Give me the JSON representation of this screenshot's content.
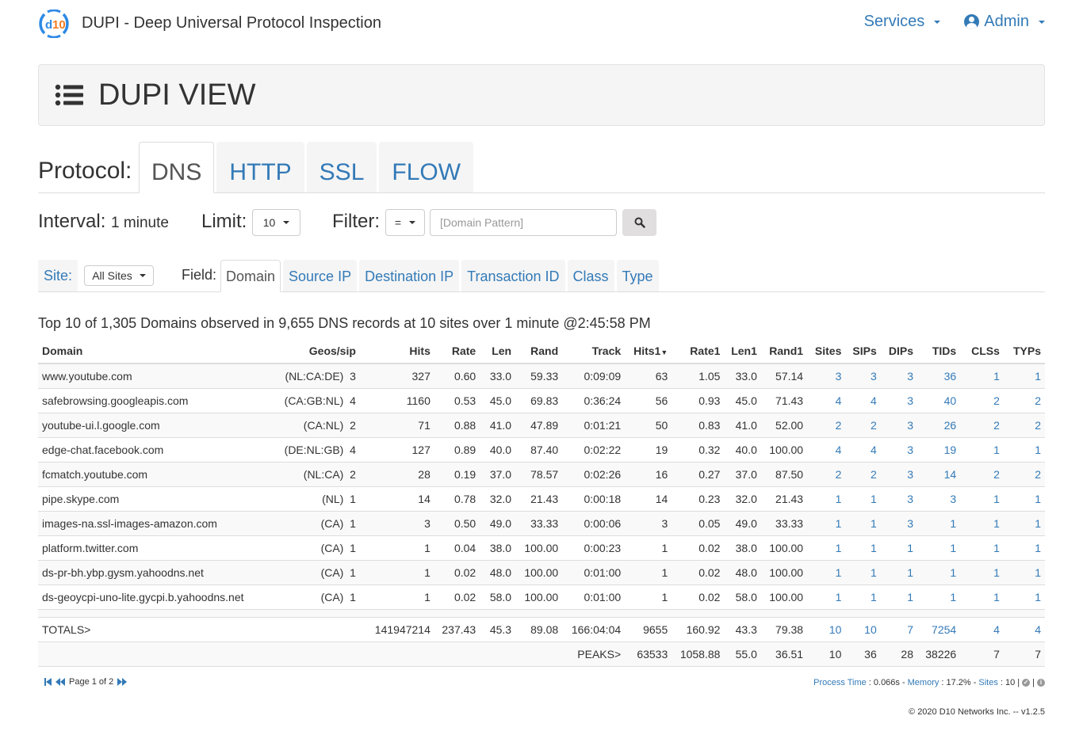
{
  "header": {
    "logo_text": "d10",
    "title": "DUPI - Deep Universal Protocol Inspection",
    "nav": {
      "services_label": "Services",
      "admin_label": "Admin"
    }
  },
  "page_title": "DUPI VIEW",
  "protocol": {
    "label": "Protocol:",
    "tabs": [
      {
        "label": "DNS",
        "active": true
      },
      {
        "label": "HTTP",
        "active": false
      },
      {
        "label": "SSL",
        "active": false
      },
      {
        "label": "FLOW",
        "active": false
      }
    ]
  },
  "controls": {
    "interval_label": "Interval:",
    "interval_value": "1 minute",
    "limit_label": "Limit:",
    "limit_value": "10",
    "filter_label": "Filter:",
    "filter_operator": "=",
    "filter_value": "",
    "filter_placeholder": "[Domain Pattern]"
  },
  "site": {
    "label": "Site:",
    "value": "All Sites"
  },
  "field": {
    "label": "Field:",
    "tabs": [
      {
        "label": "Domain",
        "active": true
      },
      {
        "label": "Source IP",
        "active": false
      },
      {
        "label": "Destination IP",
        "active": false
      },
      {
        "label": "Transaction ID",
        "active": false
      },
      {
        "label": "Class",
        "active": false
      },
      {
        "label": "Type",
        "active": false
      }
    ]
  },
  "summary": "Top 10 of 1,305 Domains observed in 9,655 DNS records at 10 sites over 1 minute @2:45:58 PM",
  "table": {
    "columns": [
      "Domain",
      "Geos/sip",
      "Hits",
      "Rate",
      "Len",
      "Rand",
      "Track",
      "Hits1",
      "Rate1",
      "Len1",
      "Rand1",
      "Sites",
      "SIPs",
      "DIPs",
      "TIDs",
      "CLSs",
      "TYPs"
    ],
    "sorted_column": "Hits1",
    "rows": [
      {
        "domain": "www.youtube.com",
        "geos": "(NL:CA:DE)",
        "sip": "3",
        "hits": "327",
        "rate": "0.60",
        "len": "33.0",
        "rand": "59.33",
        "track": "0:09:09",
        "hits1": "63",
        "rate1": "1.05",
        "len1": "33.0",
        "rand1": "57.14",
        "sites": "3",
        "sips": "3",
        "dips": "3",
        "tids": "36",
        "clss": "1",
        "typs": "1"
      },
      {
        "domain": "safebrowsing.googleapis.com",
        "geos": "(CA:GB:NL)",
        "sip": "4",
        "hits": "1160",
        "rate": "0.53",
        "len": "45.0",
        "rand": "69.83",
        "track": "0:36:24",
        "hits1": "56",
        "rate1": "0.93",
        "len1": "45.0",
        "rand1": "71.43",
        "sites": "4",
        "sips": "4",
        "dips": "3",
        "tids": "40",
        "clss": "2",
        "typs": "2"
      },
      {
        "domain": "youtube-ui.l.google.com",
        "geos": "(CA:NL)",
        "sip": "2",
        "hits": "71",
        "rate": "0.88",
        "len": "41.0",
        "rand": "47.89",
        "track": "0:01:21",
        "hits1": "50",
        "rate1": "0.83",
        "len1": "41.0",
        "rand1": "52.00",
        "sites": "2",
        "sips": "2",
        "dips": "3",
        "tids": "26",
        "clss": "2",
        "typs": "2"
      },
      {
        "domain": "edge-chat.facebook.com",
        "geos": "(DE:NL:GB)",
        "sip": "4",
        "hits": "127",
        "rate": "0.89",
        "len": "40.0",
        "rand": "87.40",
        "track": "0:02:22",
        "hits1": "19",
        "rate1": "0.32",
        "len1": "40.0",
        "rand1": "100.00",
        "sites": "4",
        "sips": "4",
        "dips": "3",
        "tids": "19",
        "clss": "1",
        "typs": "1"
      },
      {
        "domain": "fcmatch.youtube.com",
        "geos": "(NL:CA)",
        "sip": "2",
        "hits": "28",
        "rate": "0.19",
        "len": "37.0",
        "rand": "78.57",
        "track": "0:02:26",
        "hits1": "16",
        "rate1": "0.27",
        "len1": "37.0",
        "rand1": "87.50",
        "sites": "2",
        "sips": "2",
        "dips": "3",
        "tids": "14",
        "clss": "2",
        "typs": "2"
      },
      {
        "domain": "pipe.skype.com",
        "geos": "(NL)",
        "sip": "1",
        "hits": "14",
        "rate": "0.78",
        "len": "32.0",
        "rand": "21.43",
        "track": "0:00:18",
        "hits1": "14",
        "rate1": "0.23",
        "len1": "32.0",
        "rand1": "21.43",
        "sites": "1",
        "sips": "1",
        "dips": "3",
        "tids": "3",
        "clss": "1",
        "typs": "1"
      },
      {
        "domain": "images-na.ssl-images-amazon.com",
        "geos": "(CA)",
        "sip": "1",
        "hits": "3",
        "rate": "0.50",
        "len": "49.0",
        "rand": "33.33",
        "track": "0:00:06",
        "hits1": "3",
        "rate1": "0.05",
        "len1": "49.0",
        "rand1": "33.33",
        "sites": "1",
        "sips": "1",
        "dips": "3",
        "tids": "1",
        "clss": "1",
        "typs": "1"
      },
      {
        "domain": "platform.twitter.com",
        "geos": "(CA)",
        "sip": "1",
        "hits": "1",
        "rate": "0.04",
        "len": "38.0",
        "rand": "100.00",
        "track": "0:00:23",
        "hits1": "1",
        "rate1": "0.02",
        "len1": "38.0",
        "rand1": "100.00",
        "sites": "1",
        "sips": "1",
        "dips": "1",
        "tids": "1",
        "clss": "1",
        "typs": "1"
      },
      {
        "domain": "ds-pr-bh.ybp.gysm.yahoodns.net",
        "geos": "(CA)",
        "sip": "1",
        "hits": "1",
        "rate": "0.02",
        "len": "48.0",
        "rand": "100.00",
        "track": "0:01:00",
        "hits1": "1",
        "rate1": "0.02",
        "len1": "48.0",
        "rand1": "100.00",
        "sites": "1",
        "sips": "1",
        "dips": "1",
        "tids": "1",
        "clss": "1",
        "typs": "1"
      },
      {
        "domain": "ds-geoycpi-uno-lite.gycpi.b.yahoodns.net",
        "geos": "(CA)",
        "sip": "1",
        "hits": "1",
        "rate": "0.02",
        "len": "58.0",
        "rand": "100.00",
        "track": "0:01:00",
        "hits1": "1",
        "rate1": "0.02",
        "len1": "58.0",
        "rand1": "100.00",
        "sites": "1",
        "sips": "1",
        "dips": "1",
        "tids": "1",
        "clss": "1",
        "typs": "1"
      }
    ],
    "totals": {
      "label": "TOTALS>",
      "hits": "141947214",
      "rate": "237.43",
      "len": "45.3",
      "rand": "89.08",
      "track": "166:04:04",
      "hits1": "9655",
      "rate1": "160.92",
      "len1": "43.3",
      "rand1": "79.38",
      "sites": "10",
      "sips": "10",
      "dips": "7",
      "tids": "7254",
      "clss": "4",
      "typs": "4"
    },
    "peaks": {
      "label": "PEAKS>",
      "hits1": "63533",
      "rate1": "1058.88",
      "len1": "55.0",
      "rand1": "36.51",
      "sites": "10",
      "sips": "36",
      "dips": "28",
      "tids": "38226",
      "clss": "7",
      "typs": "7"
    }
  },
  "pager": {
    "text": "Page 1 of 2"
  },
  "status": {
    "process_time_label": "Process Time",
    "process_time_value": ": 0.066s - ",
    "memory_label": "Memory",
    "memory_value": ": 17.2% - ",
    "sites_label": "Sites",
    "sites_value": ": 10 |",
    "sep": "|"
  },
  "copyright": "© 2020 D10 Networks Inc. -- v1.2.5",
  "colors": {
    "link": "#337ab7",
    "logo_orange": "#f47b20",
    "logo_blue": "#2e8ae6"
  }
}
